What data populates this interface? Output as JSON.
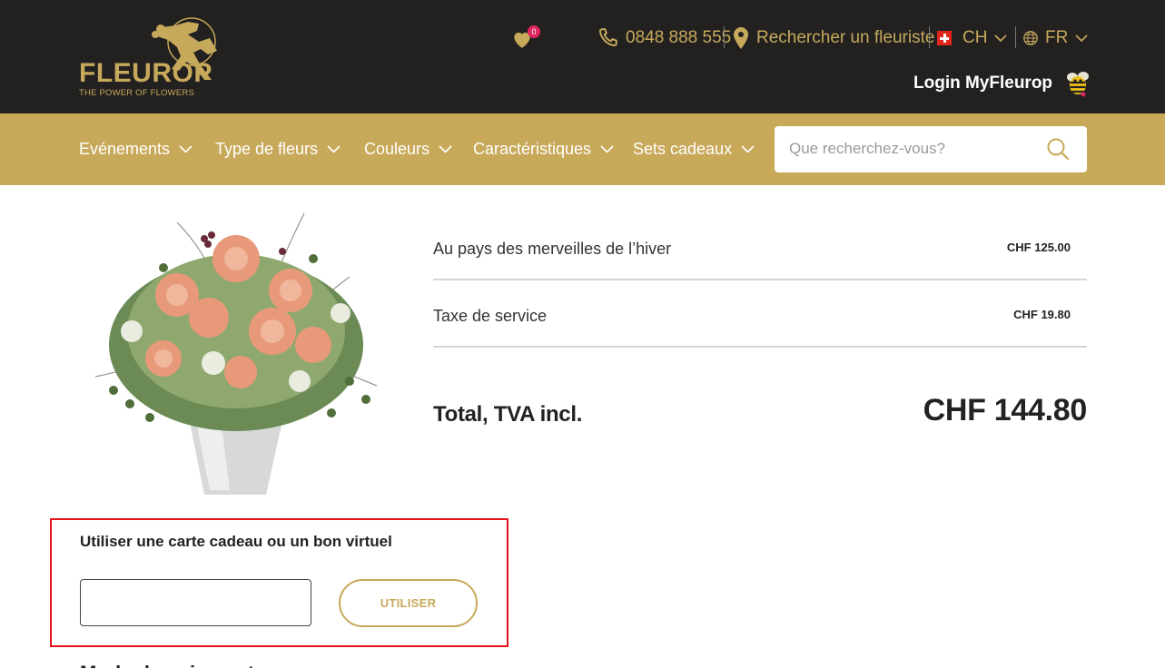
{
  "brand": {
    "name": "FLEUROP",
    "tagline": "THE POWER OF FLOWERS"
  },
  "header": {
    "wishlist_count": "0",
    "phone": "0848 888 555",
    "find_florist": "Rechercher un fleuriste",
    "country": "CH",
    "language": "FR",
    "login": "Login MyFleurop"
  },
  "nav": {
    "items": [
      {
        "label": "Evénements"
      },
      {
        "label": "Type de fleurs"
      },
      {
        "label": "Couleurs"
      },
      {
        "label": "Caractéristiques"
      },
      {
        "label": "Sets cadeaux"
      }
    ],
    "search_placeholder": "Que recherchez-vous?"
  },
  "summary": {
    "lines": [
      {
        "label": "Au pays des merveilles de l’hiver",
        "price": "CHF 125.00"
      },
      {
        "label": "Taxe de service",
        "price": "CHF 19.80"
      }
    ],
    "total_label": "Total, TVA incl.",
    "total_value": "CHF 144.80"
  },
  "gift_card": {
    "title": "Utiliser une carte cadeau ou un bon virtuel",
    "input_value": "",
    "button": "UTILISER"
  },
  "next_section_heading": "Mode de paiement",
  "colors": {
    "header_bg": "#222120",
    "gold": "#c8a95a",
    "highlight_border": "#e3141b"
  }
}
